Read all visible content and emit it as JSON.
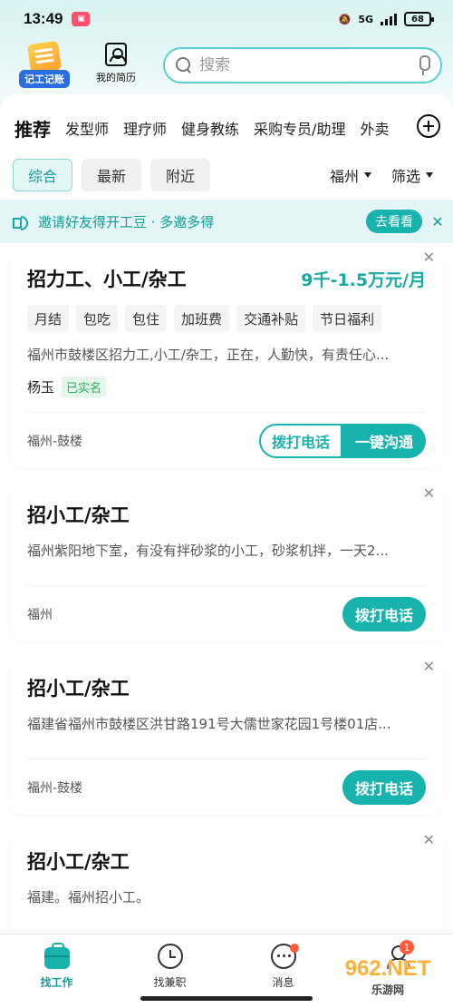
{
  "status_bar": {
    "time": "13:49",
    "network": "5G",
    "battery": "68"
  },
  "header": {
    "logo_label": "记工记账",
    "resume_label": "我的简历",
    "search_placeholder": "搜索"
  },
  "tabs": [
    "推荐",
    "发型师",
    "理疗师",
    "健身教练",
    "采购专员/助理",
    "外卖"
  ],
  "filters": {
    "chips": [
      "综合",
      "最新",
      "附近"
    ],
    "city": "福州",
    "filter_label": "筛选"
  },
  "banner": {
    "text": "邀请好友得开工豆 · 多邀多得",
    "button": "去看看"
  },
  "jobs": [
    {
      "title": "招力工、小工/杂工",
      "salary": "9千-1.5万元/月",
      "tags": [
        "月结",
        "包吃",
        "包住",
        "加班费",
        "交通补贴",
        "节日福利"
      ],
      "desc": "福州市鼓楼区招力工,小工/杂工，正在，人勤快，有责任心...",
      "user": "杨玉",
      "verified": "已实名",
      "location": "福州-鼓楼",
      "call_label": "拨打电话",
      "chat_label": "一键沟通"
    },
    {
      "title": "招小工/杂工",
      "desc": "福州紫阳地下室，有没有拌砂浆的小工，砂浆机拌，一天2...",
      "location": "福州",
      "call_label": "拨打电话"
    },
    {
      "title": "招小工/杂工",
      "desc": "福建省福州市鼓楼区洪甘路191号大儒世家花园1号楼01店...",
      "location": "福州-鼓楼",
      "call_label": "拨打电话"
    },
    {
      "title": "招小工/杂工",
      "desc": "福建。福州招小工。"
    }
  ],
  "bottom_nav": [
    {
      "label": "找工作",
      "icon": "briefcase-icon",
      "active": true
    },
    {
      "label": "找兼职",
      "icon": "clock-icon"
    },
    {
      "label": "消息",
      "icon": "chat-icon"
    },
    {
      "label": "",
      "icon": "person-icon",
      "badge": "1"
    }
  ],
  "watermark": {
    "top": "962.NET",
    "bottom": "乐游网"
  },
  "colors": {
    "accent": "#18b3ad",
    "badge": "#ff5a3c"
  }
}
